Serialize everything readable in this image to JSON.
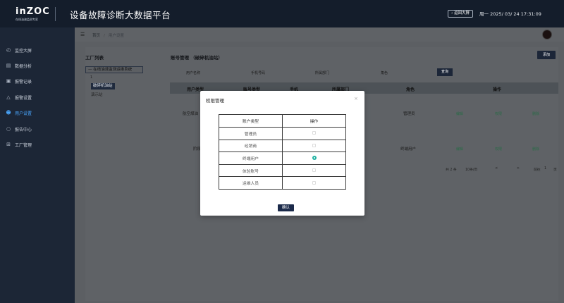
{
  "header": {
    "logo": "inZOC",
    "logo_sub": "在线油液监测专家",
    "title": "设备故障诊断大数据平台",
    "back_button": "返回大屏",
    "datetime": "周一  2025/ 03/ 24 17:31:09"
  },
  "sidebar": {
    "items": [
      {
        "label": "监控大屏",
        "icon": "monitor-icon"
      },
      {
        "label": "数据分析",
        "icon": "chart-icon"
      },
      {
        "label": "报警记录",
        "icon": "bell-icon"
      },
      {
        "label": "报警设置",
        "icon": "alarm-settings-icon"
      },
      {
        "label": "用户设置",
        "icon": "user-icon"
      },
      {
        "label": "报告中心",
        "icon": "report-icon"
      },
      {
        "label": "工厂管理",
        "icon": "factory-icon"
      }
    ],
    "active_index": 4
  },
  "breadcrumb": {
    "home": "首页",
    "separator": "/",
    "current": "用户设置"
  },
  "factory_panel": {
    "title": "工厂列表",
    "root": "— 在线油液监测运维系统",
    "node_number": "1",
    "selected_node": "破碎机油站",
    "other_node": "演示站"
  },
  "account_panel": {
    "title": "账号管理 （破碎机油站）",
    "add_button": "添加",
    "filters": {
      "username": "用户名称",
      "phone": "手机号码",
      "department": "所属部门",
      "role": "角色"
    },
    "search_button": "查询",
    "columns": [
      "用户类型",
      "账号类型",
      "手机",
      "所属部门",
      "角色",
      "操作"
    ],
    "rows": [
      {
        "user_type": "航空煤油",
        "role": "管理员",
        "actions": [
          "编辑",
          "权限",
          "删除"
        ]
      },
      {
        "user_type": "阶段",
        "role": "终端用户",
        "actions": [
          "编辑",
          "权限",
          "删除"
        ]
      }
    ],
    "pagination": {
      "total": "共 2 条",
      "page_size": "10条/页",
      "prev": "<",
      "next": ">",
      "goto_label": "前往",
      "goto_page": "1",
      "page_unit": "页"
    }
  },
  "modal": {
    "title": "权限管理",
    "close": "×",
    "header_type": "账户类型",
    "header_action": "操作",
    "rows": [
      {
        "type": "管理员",
        "selected": false
      },
      {
        "type": "经销商",
        "selected": false
      },
      {
        "type": "终端用户",
        "selected": true
      },
      {
        "type": "体验账号",
        "selected": false
      },
      {
        "type": "运维人员",
        "selected": false
      }
    ],
    "confirm": "确认"
  },
  "colors": {
    "accent": "#1c2638",
    "active_nav": "#4aa8ff",
    "radio": "#22b3a3"
  }
}
